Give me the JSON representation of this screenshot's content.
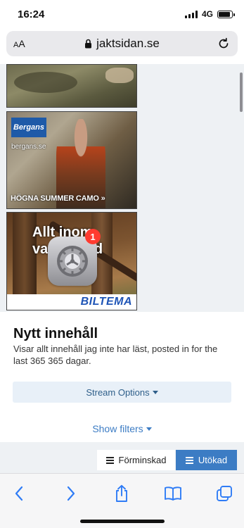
{
  "status_bar": {
    "time": "16:24",
    "network": "4G",
    "signal_icon": "cellular-signal-icon",
    "battery_icon": "battery-icon",
    "battery_level_fraction": 0.9
  },
  "url_bar": {
    "text_size_label": "AA",
    "lock_icon": "lock-icon",
    "domain": "jaktsidan.se",
    "reload_icon": "reload-icon"
  },
  "ads": {
    "bergans": {
      "logo": "Bergans",
      "site": "bergans.se",
      "caption": "HÖGNA SUMMER CAMO »"
    },
    "biltema": {
      "headline_line1": "Allt inom",
      "headline_line2": "vapenvård",
      "brand": "BILTEMA"
    }
  },
  "overlay": {
    "settings_icon": "settings-gear-icon",
    "badge_count": "1"
  },
  "content": {
    "title": "Nytt innehåll",
    "description": "Visar allt innehåll jag inte har läst, posted in for the last 365 365 dagar.",
    "stream_options_label": "Stream Options",
    "show_filters_label": "Show filters"
  },
  "view_toggle": {
    "condensed_label": "Förminskad",
    "expanded_label": "Utökad",
    "active": "expanded",
    "active_color": "#3c7cc4"
  },
  "toolbar": {
    "back_icon": "chevron-left-icon",
    "forward_icon": "chevron-right-icon",
    "share_icon": "share-icon",
    "bookmarks_icon": "book-icon",
    "tabs_icon": "tabs-icon"
  }
}
